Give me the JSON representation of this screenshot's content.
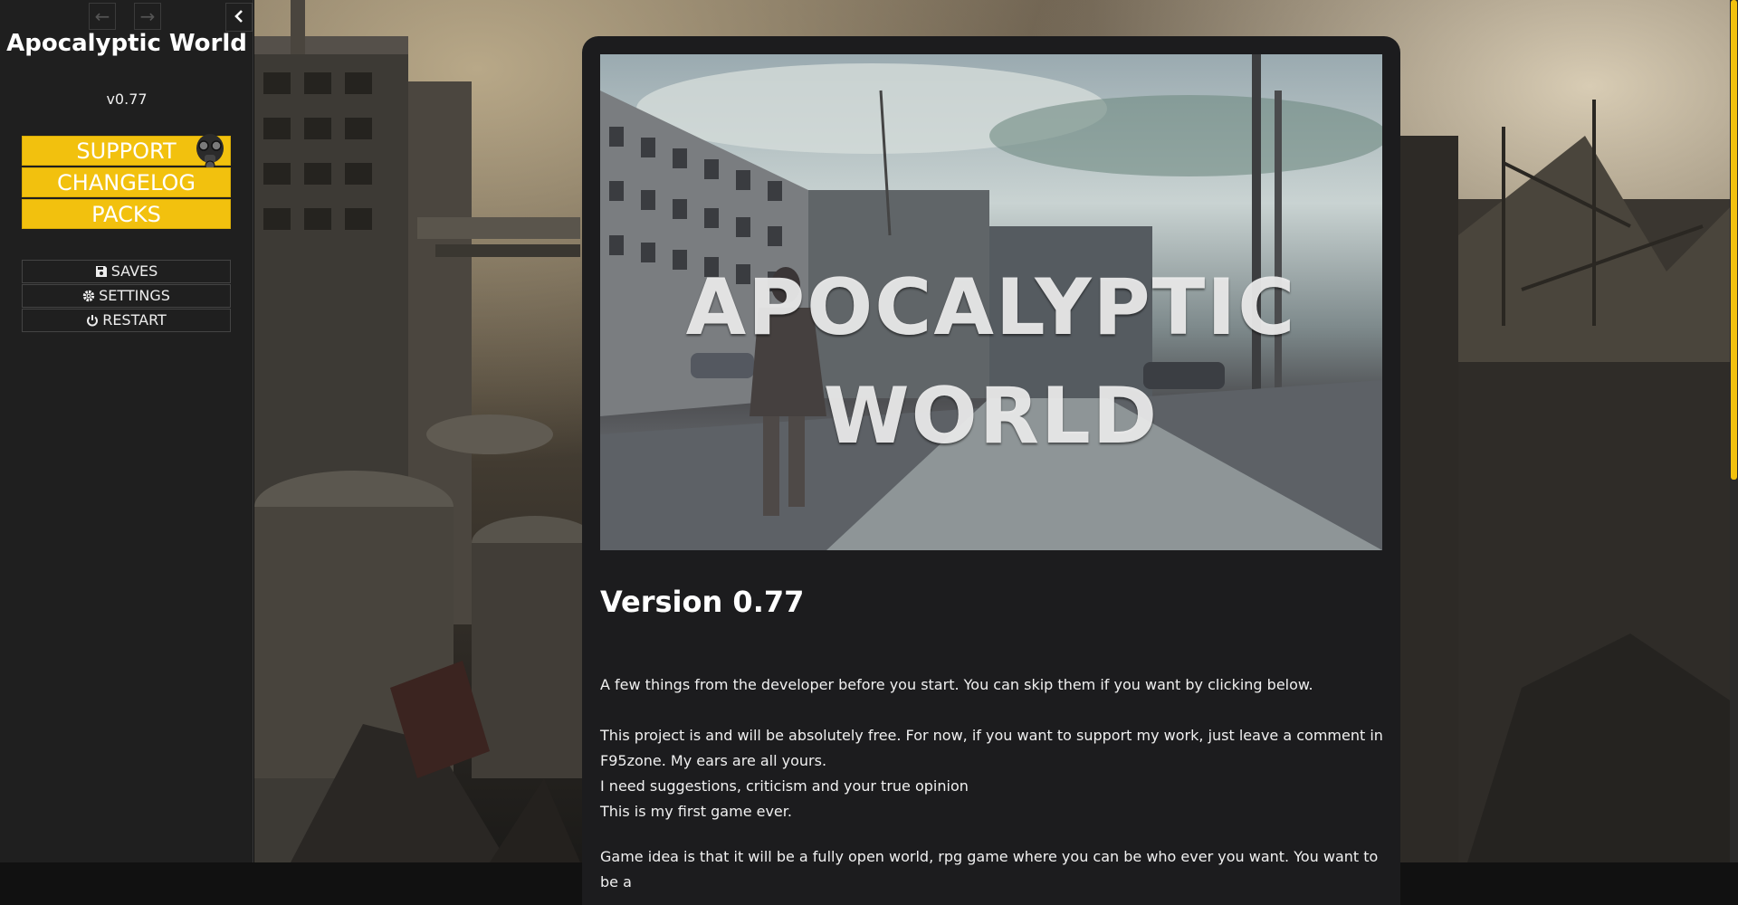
{
  "sidebar": {
    "back_icon": "arrow-left-icon",
    "forward_icon": "arrow-right-icon",
    "toggle_icon": "chevron-left-icon",
    "title": "Apocalyptic World",
    "version": "v0.77",
    "buttons": [
      {
        "label": "SUPPORT"
      },
      {
        "label": "CHANGELOG"
      },
      {
        "label": "PACKS"
      }
    ],
    "menu": [
      {
        "label": "SAVES",
        "icon": "save-icon"
      },
      {
        "label": "SETTINGS",
        "icon": "gear-icon"
      },
      {
        "label": "RESTART",
        "icon": "power-icon"
      }
    ]
  },
  "passage": {
    "banner_title": "APOCALYPTIC WORLD",
    "heading": "Version 0.77",
    "paragraphs": [
      "A few things from the developer before you start. You can skip them if you want by clicking below.",
      "This project is and will be absolutely free. For now, if you want to support my work, just leave a comment in F95zone. My ears are all yours.",
      "I need suggestions, criticism and your true opinion",
      "This is my first game ever.",
      "Game idea is that it will be a fully open world, rpg game where you can be who ever you want. You want to be a"
    ]
  },
  "colors": {
    "accent": "#f2c10e",
    "sidebar_bg": "#1f1f1f",
    "passage_bg": "#1c1c1e"
  }
}
